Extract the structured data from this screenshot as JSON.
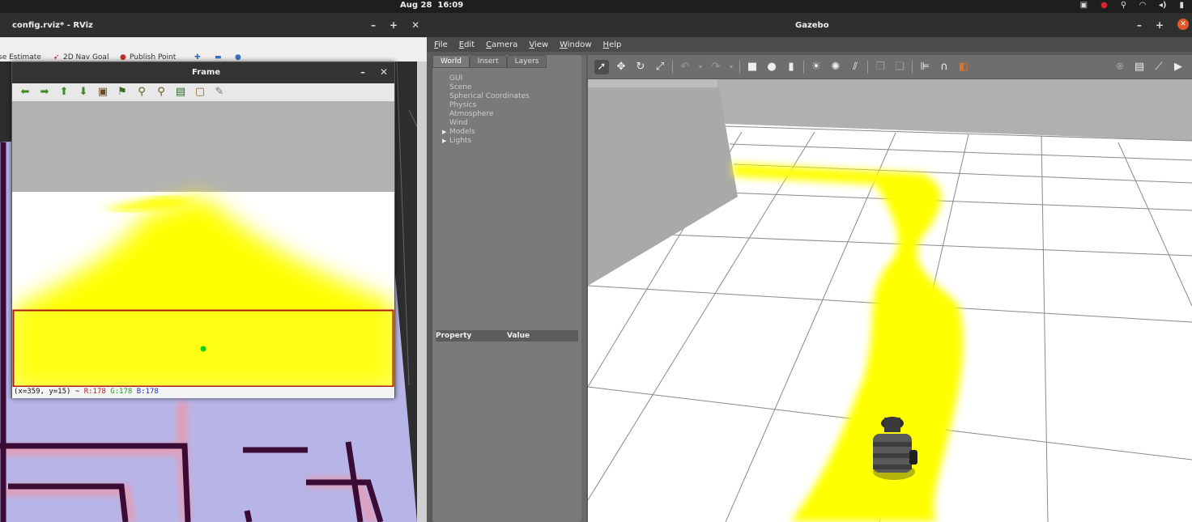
{
  "system_bar": {
    "date": "Aug 28",
    "time": "16:09"
  },
  "rviz": {
    "window_title": "config.rviz* - RViz",
    "toolbar": [
      {
        "label": "se Estimate"
      },
      {
        "label": "2D Nav Goal"
      },
      {
        "label": "Publish Point"
      }
    ]
  },
  "frame_window": {
    "title": "Frame",
    "tool_icons": [
      "arrow-left-icon",
      "arrow-right-icon",
      "arrow-up-icon",
      "arrow-down-icon",
      "image-icon",
      "fit-icon",
      "zoom-in-icon",
      "zoom-out-icon",
      "save-icon",
      "copy-icon",
      "properties-icon"
    ],
    "status": {
      "coords": "(x=359, y=15) ~ ",
      "r": "R:178",
      "g": "G:178",
      "b": "B:178"
    }
  },
  "gazebo": {
    "window_title": "Gazebo",
    "menu": [
      "File",
      "Edit",
      "Camera",
      "View",
      "Window",
      "Help"
    ],
    "tabs": [
      "World",
      "Insert",
      "Layers"
    ],
    "tree": [
      {
        "label": "GUI",
        "expandable": false
      },
      {
        "label": "Scene",
        "expandable": false
      },
      {
        "label": "Spherical Coordinates",
        "expandable": false
      },
      {
        "label": "Physics",
        "expandable": false
      },
      {
        "label": "Atmosphere",
        "expandable": false
      },
      {
        "label": "Wind",
        "expandable": false
      },
      {
        "label": "Models",
        "expandable": true
      },
      {
        "label": "Lights",
        "expandable": true
      }
    ],
    "property_header": {
      "property": "Property",
      "value": "Value"
    }
  },
  "colors": {
    "line_yellow": "#ffff00",
    "tray_red": "#d7262a",
    "status_r": "#c02020",
    "status_g": "#1c9a1c",
    "status_b": "#2030c0"
  }
}
